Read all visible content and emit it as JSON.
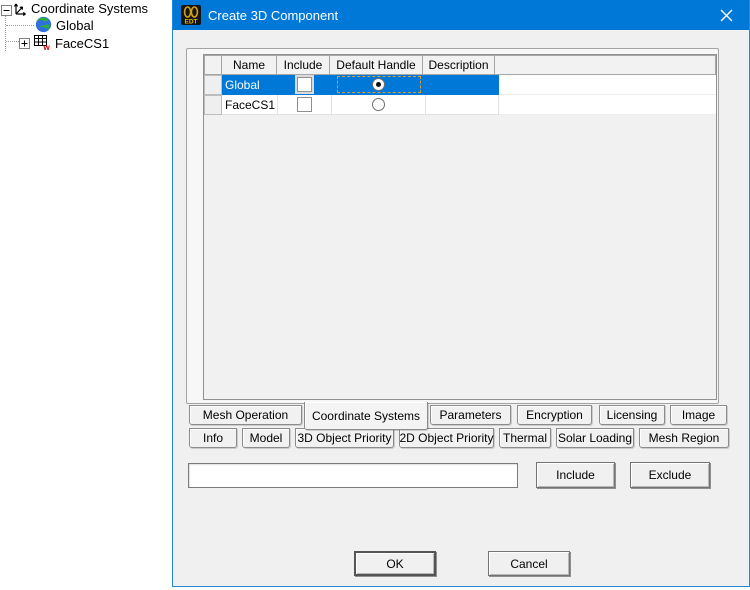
{
  "window": {
    "title": "Create 3D Component",
    "app_icon_text": "EDT",
    "close_glyph": "✕"
  },
  "colors": {
    "titlebar_blue": "#0078d7",
    "selection_blue": "#0078d7",
    "dialog_bg": "#f0f0f0",
    "dialog_border_blue": "#2586d7",
    "app_icon_gold": "#d4a017"
  },
  "tree": {
    "items": [
      {
        "label": "Coordinate Systems",
        "icon": "coordinate-axes-icon",
        "expander": "collapse"
      },
      {
        "label": "Global",
        "icon": "globe-icon",
        "expander": null
      },
      {
        "label": "FaceCS1",
        "icon": "face-grid-icon",
        "expander": "expand"
      }
    ]
  },
  "grid": {
    "columns": [
      "Name",
      "Include",
      "Default Handle",
      "Description"
    ],
    "rows": [
      {
        "name": "Global",
        "include": false,
        "default_handle": true,
        "description": "",
        "selected": true,
        "focus": true
      },
      {
        "name": "FaceCS1",
        "include": false,
        "default_handle": false,
        "description": "",
        "selected": false,
        "focus": false
      }
    ]
  },
  "tabs": {
    "row1": [
      {
        "label": "Mesh Operation",
        "active": false
      },
      {
        "label": "Coordinate Systems",
        "active": true
      },
      {
        "label": "Parameters",
        "active": false
      },
      {
        "label": "Encryption",
        "active": false
      },
      {
        "label": "Licensing",
        "active": false
      },
      {
        "label": "Image",
        "active": false
      }
    ],
    "row2": [
      {
        "label": "Info",
        "active": false
      },
      {
        "label": "Model",
        "active": false
      },
      {
        "label": "3D Object Priority",
        "active": false
      },
      {
        "label": "2D Object Priority",
        "active": false
      },
      {
        "label": "Thermal",
        "active": false
      },
      {
        "label": "Solar Loading",
        "active": false
      },
      {
        "label": "Mesh Region",
        "active": false
      }
    ]
  },
  "filter": {
    "input_value": "",
    "include_label": "Include",
    "exclude_label": "Exclude"
  },
  "actions": {
    "ok": "OK",
    "cancel": "Cancel"
  }
}
